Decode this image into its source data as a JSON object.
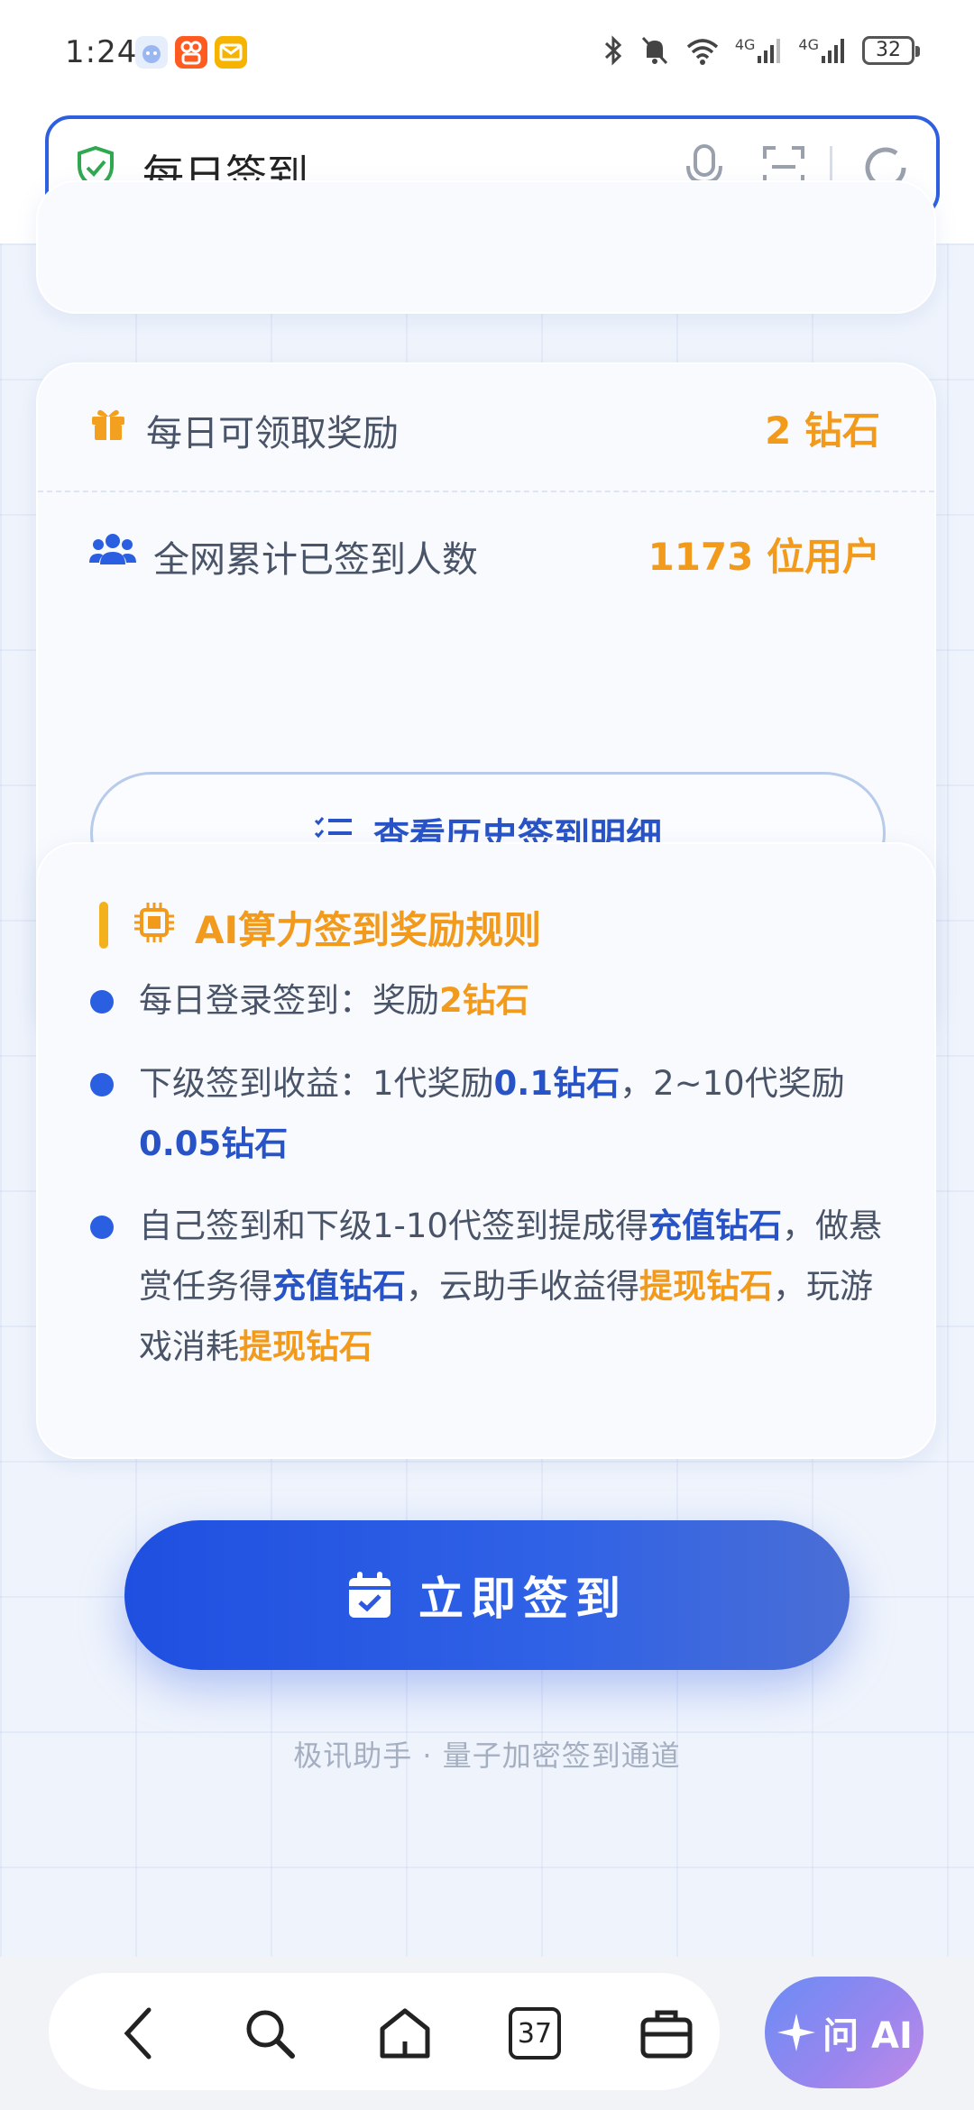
{
  "status_bar": {
    "time": "1:24",
    "signal_1": "4G",
    "signal_2": "4G",
    "battery": "32"
  },
  "search": {
    "query": "每日签到"
  },
  "stats": {
    "daily_reward_label": "每日可领取奖励",
    "daily_reward_value": "2 钻石",
    "total_users_label": "全网累计已签到人数",
    "total_users_value": "1173 位用户",
    "history_button_label": "查看历史签到明细"
  },
  "rules": {
    "title": "AI算力签到奖励规则",
    "items": [
      {
        "parts": [
          {
            "text": "每日登录签到：奖励",
            "style": "plain"
          },
          {
            "text": "2钻石",
            "style": "orange"
          }
        ]
      },
      {
        "parts": [
          {
            "text": "下级签到收益：1代奖励",
            "style": "plain"
          },
          {
            "text": "0.1钻石",
            "style": "blue"
          },
          {
            "text": "，2~10代奖励",
            "style": "plain"
          },
          {
            "text": "0.05钻石",
            "style": "blue"
          }
        ]
      },
      {
        "parts": [
          {
            "text": "自己签到和下级1-10代签到提成得",
            "style": "plain"
          },
          {
            "text": "充值钻石",
            "style": "blue"
          },
          {
            "text": "，做悬赏任务得",
            "style": "plain"
          },
          {
            "text": "充值钻石",
            "style": "blue"
          },
          {
            "text": "，云助手收益得",
            "style": "plain"
          },
          {
            "text": "提现钻石",
            "style": "orange"
          },
          {
            "text": "，玩游戏消耗",
            "style": "plain"
          },
          {
            "text": "提现钻石",
            "style": "orange"
          }
        ]
      }
    ]
  },
  "sign_button_label": "立即签到",
  "footer": "极讯助手 · 量子加密签到通道",
  "bottom_nav": {
    "tabs_count": "37",
    "ai_label": "问 AI"
  },
  "colors": {
    "accent_blue": "#2853c6",
    "accent_orange": "#f29a1b",
    "button_blue": "#1f4fe0"
  }
}
